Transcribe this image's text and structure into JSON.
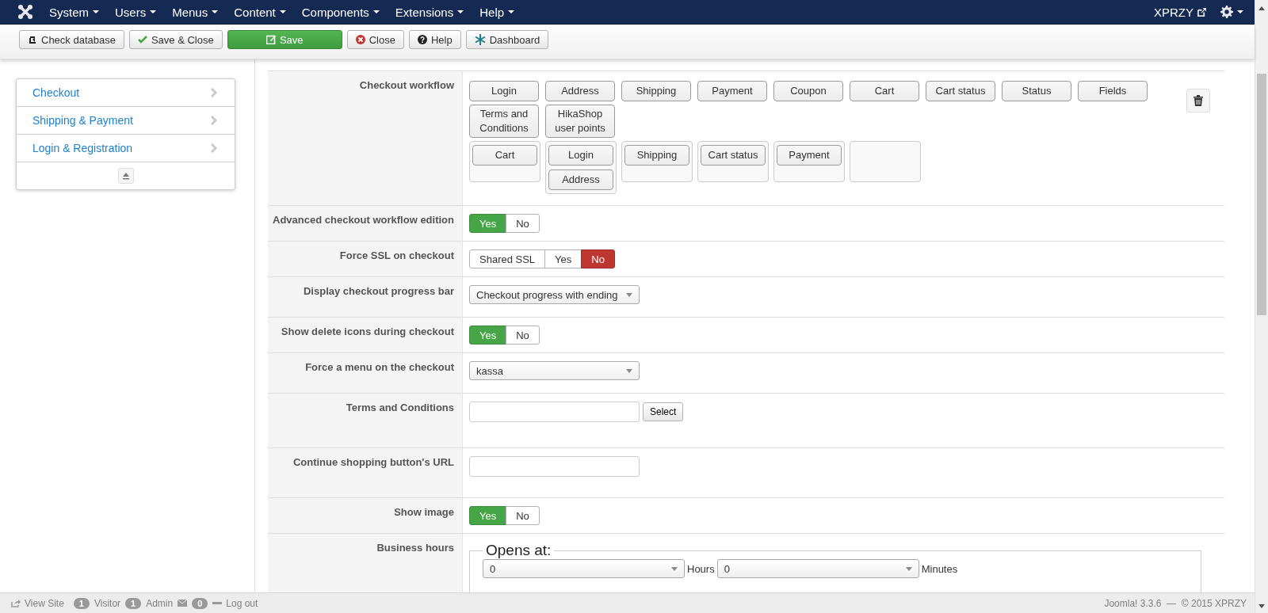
{
  "navbar": {
    "menus": [
      {
        "label": "System"
      },
      {
        "label": "Users"
      },
      {
        "label": "Menus"
      },
      {
        "label": "Content"
      },
      {
        "label": "Components"
      },
      {
        "label": "Extensions"
      },
      {
        "label": "Help"
      }
    ],
    "site_link": "XPRZY"
  },
  "toolbar": {
    "buttons": [
      {
        "label": "Check database",
        "kind": "check"
      },
      {
        "label": "Save & Close",
        "kind": "save-close"
      },
      {
        "label": "Save",
        "kind": "save"
      },
      {
        "label": "Close",
        "kind": "close"
      },
      {
        "label": "Help",
        "kind": "help"
      },
      {
        "label": "Dashboard",
        "kind": "dashboard"
      }
    ]
  },
  "sidebar": {
    "items": [
      {
        "label": "Checkout"
      },
      {
        "label": "Shipping & Payment"
      },
      {
        "label": "Login & Registration"
      }
    ]
  },
  "settings": [
    {
      "kind": "workflow",
      "label": "Checkout workflow",
      "available": [
        "Login",
        "Address",
        "Shipping",
        "Payment",
        "Coupon",
        "Cart",
        "Cart status",
        "Status",
        "Fields",
        "Terms and Conditions",
        "HikaShop user points"
      ],
      "steps": [
        {
          "kind": "step",
          "blocks": [
            "Cart"
          ]
        },
        {
          "kind": "step",
          "blocks": [
            "Login",
            "Address"
          ]
        },
        {
          "kind": "step",
          "blocks": [
            "Shipping"
          ]
        },
        {
          "kind": "step",
          "blocks": [
            "Cart status"
          ]
        },
        {
          "kind": "step",
          "blocks": [
            "Payment"
          ]
        },
        {
          "kind": "new-step"
        }
      ]
    },
    {
      "kind": "toggle",
      "label": "Advanced checkout workflow edition",
      "options": [
        {
          "label": "Yes",
          "kind": "yes",
          "selected": true
        },
        {
          "label": "No",
          "kind": "no",
          "selected": false
        }
      ]
    },
    {
      "kind": "toggle",
      "label": "Force SSL on checkout",
      "options": [
        {
          "label": "Shared SSL",
          "kind": "other",
          "selected": false
        },
        {
          "label": "Yes",
          "kind": "yes",
          "selected": false
        },
        {
          "label": "No",
          "kind": "no",
          "selected": true
        }
      ]
    },
    {
      "kind": "select",
      "label": "Display checkout progress bar",
      "value": "Checkout progress with ending"
    },
    {
      "kind": "toggle",
      "label": "Show delete icons during checkout",
      "options": [
        {
          "label": "Yes",
          "kind": "yes",
          "selected": true
        },
        {
          "label": "No",
          "kind": "no",
          "selected": false
        }
      ]
    },
    {
      "kind": "select",
      "label": "Force a menu on the checkout",
      "value": "kassa"
    },
    {
      "kind": "text-select",
      "label": "Terms and Conditions",
      "button": "Select"
    },
    {
      "kind": "text",
      "label": "Continue shopping button's URL"
    },
    {
      "kind": "toggle",
      "label": "Show image",
      "options": [
        {
          "label": "Yes",
          "kind": "yes",
          "selected": true
        },
        {
          "label": "No",
          "kind": "no",
          "selected": false
        }
      ]
    },
    {
      "kind": "hours",
      "label": "Business hours",
      "legend": "Opens at:",
      "hours": "0",
      "hours_unit": "Hours",
      "minutes": "0",
      "minutes_unit": "Minutes"
    }
  ],
  "status_bar": {
    "view_site": "View Site",
    "visitors": "1",
    "visitors_label": "Visitor",
    "admins": "1",
    "admins_label": "Admin",
    "messages": "0",
    "logout": "Log out",
    "version": "Joomla! 3.3.6  —  © 2015 XPRZY"
  }
}
